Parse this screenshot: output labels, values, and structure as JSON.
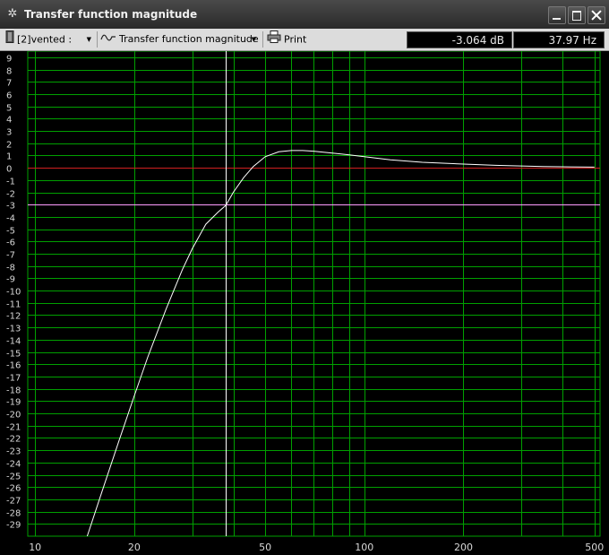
{
  "window": {
    "title": "Transfer function magnitude"
  },
  "toolbar": {
    "driver_dropdown": "[2]vented :",
    "graph_dropdown": "Transfer function magnitude",
    "print_label": "Print",
    "readout_db": "-3.064 dB",
    "readout_hz": "37.97 Hz"
  },
  "colors": {
    "grid": "#00a000",
    "zero_line": "#d02020",
    "marker_line": "#ff9cff",
    "cursor_line": "#ffffff",
    "curve": "#ffffff",
    "background": "#000000"
  },
  "icons": {
    "app": "gear-icon",
    "driver": "speaker-icon",
    "graph": "waveform-icon",
    "print": "printer-icon"
  },
  "chart_data": {
    "type": "line",
    "x_scale": "log",
    "xlim": [
      9.5,
      520
    ],
    "ylim": [
      -30,
      9.5
    ],
    "x_tick_labels": [
      {
        "value": 10,
        "label": "10"
      },
      {
        "value": 20,
        "label": "20"
      },
      {
        "value": 50,
        "label": "50"
      },
      {
        "value": 100,
        "label": "100"
      },
      {
        "value": 200,
        "label": "200"
      },
      {
        "value": 500,
        "label": "500"
      }
    ],
    "x_gridlines": [
      10,
      20,
      30,
      40,
      50,
      60,
      70,
      80,
      90,
      100,
      200,
      300,
      400,
      500
    ],
    "y_ticks": [
      9,
      8,
      7,
      6,
      5,
      4,
      3,
      2,
      1,
      0,
      -1,
      -2,
      -3,
      -4,
      -5,
      -6,
      -7,
      -8,
      -9,
      -10,
      -11,
      -12,
      -13,
      -14,
      -15,
      -16,
      -17,
      -18,
      -19,
      -20,
      -21,
      -22,
      -23,
      -24,
      -25,
      -26,
      -27,
      -28,
      -29
    ],
    "series": [
      {
        "x": [
          14.4,
          16,
          18,
          20,
          22,
          25,
          28,
          30,
          33,
          36,
          37.97,
          40,
          43,
          46,
          50,
          55,
          60,
          65,
          70,
          80,
          90,
          100,
          120,
          150,
          200,
          250,
          300,
          350,
          400,
          500
        ],
        "y": [
          -30,
          -26.3,
          -22.2,
          -18.6,
          -15.4,
          -11.5,
          -8.3,
          -6.6,
          -4.6,
          -3.6,
          -3.06,
          -2.0,
          -0.8,
          0.1,
          0.9,
          1.3,
          1.4,
          1.4,
          1.35,
          1.2,
          1.05,
          0.9,
          0.65,
          0.45,
          0.3,
          0.2,
          0.15,
          0.1,
          0.08,
          0.05
        ]
      }
    ],
    "reference_lines": {
      "zero_db": 0,
      "minus3_db": -3,
      "cursor_hz": 37.97
    }
  }
}
